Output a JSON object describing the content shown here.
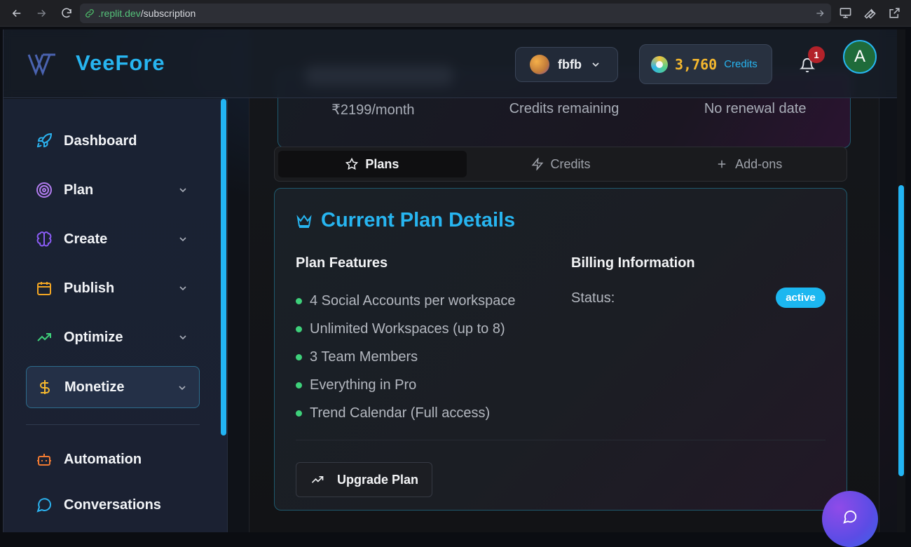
{
  "browser": {
    "url_domain": ".replit.dev",
    "url_path": "/subscription"
  },
  "header": {
    "logo_text": "VeeFore",
    "workspace_name": "fbfb",
    "credits_amount": "3,760",
    "credits_label": "Credits",
    "notification_count": "1",
    "user_initial": "A"
  },
  "summary": {
    "price": "₹2199/month",
    "credits_text": "Credits remaining",
    "renewal_text": "No renewal date"
  },
  "sidebar": {
    "items": [
      {
        "label": "Dashboard",
        "icon": "rocket-icon",
        "has_chevron": false
      },
      {
        "label": "Plan",
        "icon": "target-icon",
        "has_chevron": true
      },
      {
        "label": "Create",
        "icon": "brain-icon",
        "has_chevron": true
      },
      {
        "label": "Publish",
        "icon": "calendar-icon",
        "has_chevron": true
      },
      {
        "label": "Optimize",
        "icon": "trending-up-icon",
        "has_chevron": true
      },
      {
        "label": "Monetize",
        "icon": "dollar-icon",
        "has_chevron": true,
        "active": true
      },
      {
        "label": "Automation",
        "icon": "bot-icon",
        "has_chevron": false
      },
      {
        "label": "Conversations",
        "icon": "chat-icon",
        "has_chevron": false
      }
    ]
  },
  "tabs": [
    {
      "label": "Plans",
      "icon": "star-icon",
      "active": true
    },
    {
      "label": "Credits",
      "icon": "zap-icon",
      "active": false
    },
    {
      "label": "Add-ons",
      "icon": "plus-icon",
      "active": false
    }
  ],
  "plan_card": {
    "title": "Current Plan Details",
    "features_heading": "Plan Features",
    "billing_heading": "Billing Information",
    "features": [
      "4 Social Accounts per workspace",
      "Unlimited Workspaces (up to 8)",
      "3 Team Members",
      "Everything in Pro",
      "Trend Calendar (Full access)"
    ],
    "status_label": "Status:",
    "status_value": "active",
    "upgrade_label": "Upgrade Plan"
  },
  "colors": {
    "accent": "#27b5f0",
    "credits": "#f5b82e",
    "feature_dot": "#3ed07a",
    "badge_red": "#b3222a"
  }
}
